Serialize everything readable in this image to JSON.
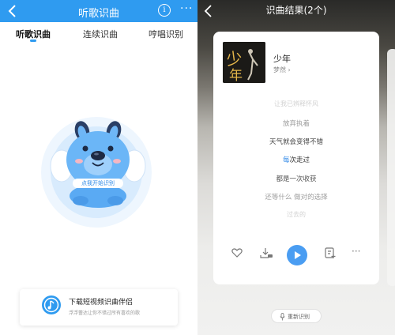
{
  "left": {
    "header": {
      "title": "听歌识曲",
      "info_glyph": "i",
      "more_glyph": "···"
    },
    "tabs": [
      {
        "label": "听歌识曲"
      },
      {
        "label": "连续识曲"
      },
      {
        "label": "哼唱识别"
      }
    ],
    "tap_label": "点我开始识别",
    "banner": {
      "title": "下载短视频识曲伴侣",
      "subtitle": "浮浮蕾达让你不错过所有喜欢的歌"
    }
  },
  "right": {
    "header": {
      "title": "识曲结果(2个)"
    },
    "song": {
      "title": "少年",
      "artist": "梦然",
      "artist_chevron": "›"
    },
    "cover_text": "少年",
    "lyrics": [
      {
        "text": "让我已辨释怀风"
      },
      {
        "text": "放弃执着"
      },
      {
        "text": "天气就会变得不错"
      },
      {
        "text": "每次走过",
        "highlight": "每"
      },
      {
        "text": "都是一次收获"
      },
      {
        "text": "还等什么 做对的选择"
      },
      {
        "text": "过去的"
      }
    ],
    "controls": [
      "heart-icon",
      "download-icon",
      "play-icon",
      "add-to-list-icon",
      "more-icon"
    ],
    "more_glyph": "···",
    "retry_label": "重新识别"
  },
  "colors": {
    "accent": "#2f9bf0",
    "play": "#4a9df2"
  }
}
